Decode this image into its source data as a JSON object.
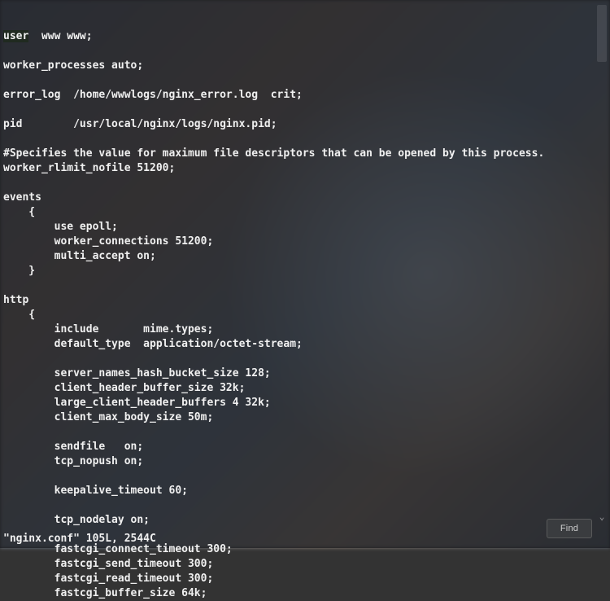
{
  "editor": {
    "file_name": "nginx.conf",
    "line_count": "105L",
    "char_count": "2544C",
    "status_line": "\"nginx.conf\" 105L, 2544C",
    "find_label": "Find",
    "scroll_down_glyph": "⌄",
    "lines": [
      "user  www www;",
      "",
      "worker_processes auto;",
      "",
      "error_log  /home/wwwlogs/nginx_error.log  crit;",
      "",
      "pid        /usr/local/nginx/logs/nginx.pid;",
      "",
      "#Specifies the value for maximum file descriptors that can be opened by this process.",
      "worker_rlimit_nofile 51200;",
      "",
      "events",
      "    {",
      "        use epoll;",
      "        worker_connections 51200;",
      "        multi_accept on;",
      "    }",
      "",
      "http",
      "    {",
      "        include       mime.types;",
      "        default_type  application/octet-stream;",
      "",
      "        server_names_hash_bucket_size 128;",
      "        client_header_buffer_size 32k;",
      "        large_client_header_buffers 4 32k;",
      "        client_max_body_size 50m;",
      "",
      "        sendfile   on;",
      "        tcp_nopush on;",
      "",
      "        keepalive_timeout 60;",
      "",
      "        tcp_nodelay on;",
      "",
      "        fastcgi_connect_timeout 300;",
      "        fastcgi_send_timeout 300;",
      "        fastcgi_read_timeout 300;",
      "        fastcgi_buffer_size 64k;"
    ]
  }
}
